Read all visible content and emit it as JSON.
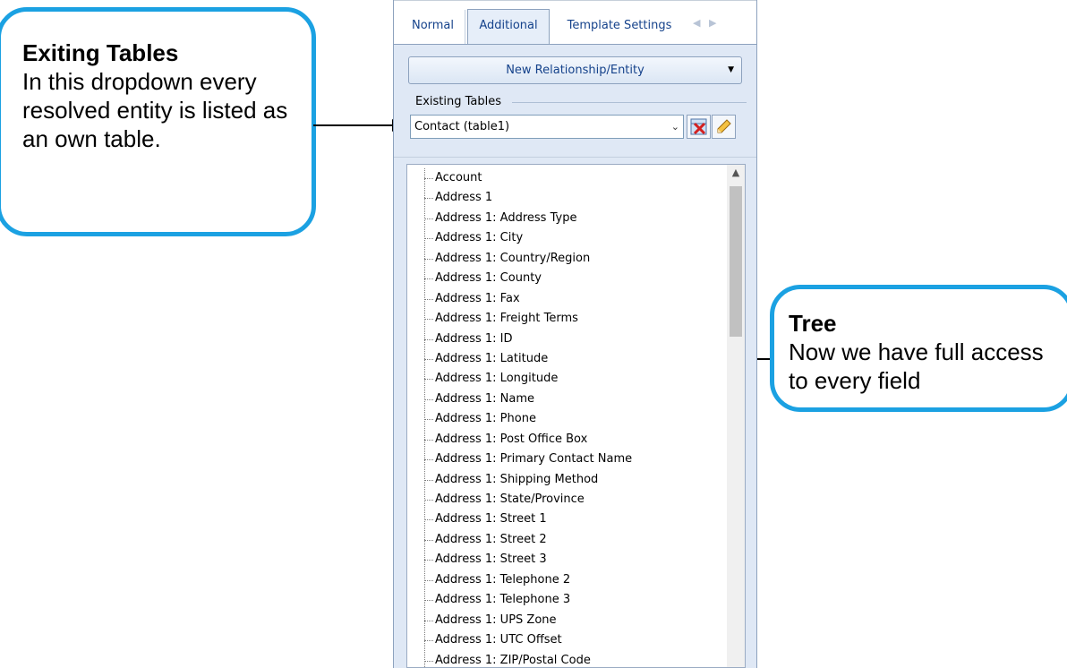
{
  "callouts": {
    "left": {
      "title": "Exiting Tables",
      "body": "In this dropdown every resolved entity is listed as an own table."
    },
    "right": {
      "title": "Tree",
      "body": "Now we have full access to every field"
    }
  },
  "tabs": [
    "Normal",
    "Additional",
    "Template Settings"
  ],
  "new_relationship_button": "New Relationship/Entity",
  "existing_tables": {
    "label": "Existing Tables",
    "selected": "Contact  (table1)"
  },
  "tree_items": [
    "Account",
    "Address 1",
    "Address 1: Address Type",
    "Address 1: City",
    "Address 1: Country/Region",
    "Address 1: County",
    "Address 1: Fax",
    "Address 1: Freight Terms",
    "Address 1: ID",
    "Address 1: Latitude",
    "Address 1: Longitude",
    "Address 1: Name",
    "Address 1: Phone",
    "Address 1: Post Office Box",
    "Address 1: Primary Contact Name",
    "Address 1: Shipping Method",
    "Address 1: State/Province",
    "Address 1: Street 1",
    "Address 1: Street 2",
    "Address 1: Street 3",
    "Address 1: Telephone 2",
    "Address 1: Telephone 3",
    "Address 1: UPS Zone",
    "Address 1: UTC Offset",
    "Address 1: ZIP/Postal Code"
  ],
  "colors": {
    "callout_border": "#1ba1e2",
    "panel_bg": "#dfe8f5",
    "tab_text": "#15428b"
  }
}
